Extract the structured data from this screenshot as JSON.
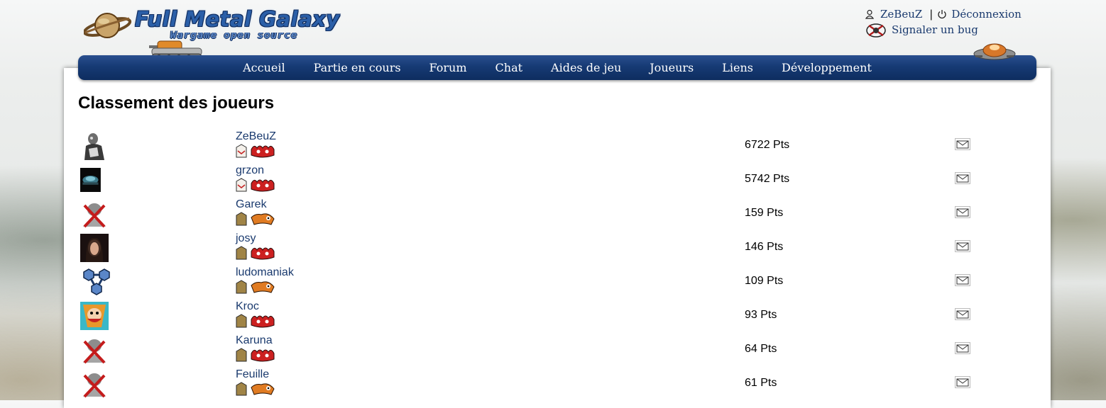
{
  "logo": {
    "title": "Full Metal Galaxy",
    "subtitle": "Wargame open source"
  },
  "user_links": {
    "username": "ZeBeuZ",
    "separator": "|",
    "logout": "Déconnexion",
    "report_bug": "Signaler un bug"
  },
  "nav": {
    "items": [
      "Accueil",
      "Partie en cours",
      "Forum",
      "Chat",
      "Aides de jeu",
      "Joueurs",
      "Liens",
      "Développement"
    ]
  },
  "page": {
    "title": "Classement des joueurs"
  },
  "players": [
    {
      "name": "ZeBeuZ",
      "points": "6722 Pts",
      "avatar": "robot-avatar",
      "rank_badge": "white-rank-badge",
      "faction_badge": "red-faction-badge"
    },
    {
      "name": "grzon",
      "points": "5742 Pts",
      "avatar": "tank-photo-avatar",
      "rank_badge": "white-rank-badge",
      "faction_badge": "red-faction-badge"
    },
    {
      "name": "Garek",
      "points": "159 Pts",
      "avatar": "no-avatar",
      "rank_badge": "bronze-rank-badge",
      "faction_badge": "orange-faction-badge"
    },
    {
      "name": "josy",
      "points": "146 Pts",
      "avatar": "portrait-avatar",
      "rank_badge": "bronze-rank-badge",
      "faction_badge": "red-faction-badge"
    },
    {
      "name": "ludomaniak",
      "points": "109 Pts",
      "avatar": "molecule-avatar",
      "rank_badge": "bronze-rank-badge",
      "faction_badge": "orange-faction-badge"
    },
    {
      "name": "Kroc",
      "points": "93 Pts",
      "avatar": "cartoon-avatar",
      "rank_badge": "bronze-rank-badge",
      "faction_badge": "red-faction-badge"
    },
    {
      "name": "Karuna",
      "points": "64 Pts",
      "avatar": "no-avatar",
      "rank_badge": "bronze-rank-badge",
      "faction_badge": "red-faction-badge"
    },
    {
      "name": "Feuille",
      "points": "61 Pts",
      "avatar": "no-avatar",
      "rank_badge": "bronze-rank-badge",
      "faction_badge": "orange-faction-badge"
    }
  ],
  "colors": {
    "nav_bar": "#163a74",
    "link": "#1a3a6e"
  }
}
